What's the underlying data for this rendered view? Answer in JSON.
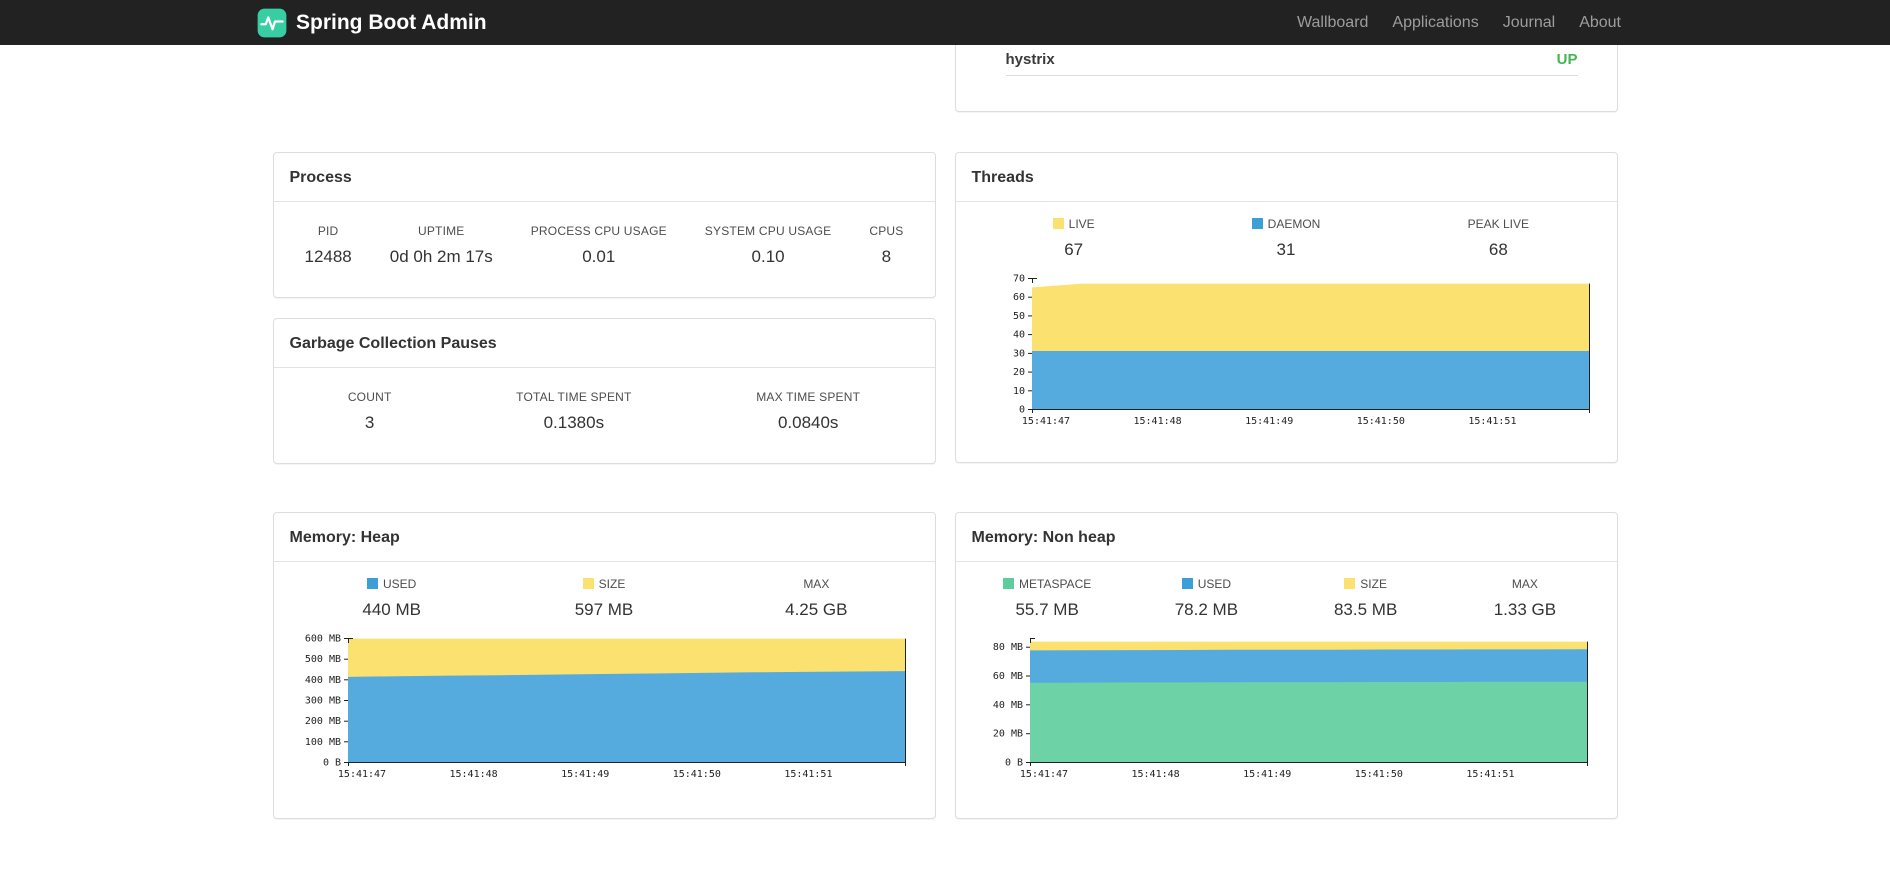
{
  "navbar": {
    "brand": "Spring Boot Admin",
    "items": [
      {
        "label": "Wallboard"
      },
      {
        "label": "Applications"
      },
      {
        "label": "Journal"
      },
      {
        "label": "About"
      }
    ]
  },
  "health": {
    "name": "hystrix",
    "status": "UP",
    "status_color": "#44b553"
  },
  "process": {
    "title": "Process",
    "stats": [
      {
        "label": "PID",
        "value": "12488"
      },
      {
        "label": "UPTIME",
        "value": "0d 0h 2m 17s"
      },
      {
        "label": "PROCESS CPU USAGE",
        "value": "0.01"
      },
      {
        "label": "SYSTEM CPU USAGE",
        "value": "0.10"
      },
      {
        "label": "CPUS",
        "value": "8"
      }
    ]
  },
  "gc": {
    "title": "Garbage Collection Pauses",
    "stats": [
      {
        "label": "COUNT",
        "value": "3"
      },
      {
        "label": "TOTAL TIME SPENT",
        "value": "0.1380s"
      },
      {
        "label": "MAX TIME SPENT",
        "value": "0.0840s"
      }
    ]
  },
  "threads": {
    "title": "Threads",
    "legend": [
      {
        "label": "LIVE",
        "value": "67",
        "swatch": "#fbe170"
      },
      {
        "label": "DAEMON",
        "value": "31",
        "swatch": "#3d9fd8"
      },
      {
        "label": "PEAK LIVE",
        "value": "68",
        "swatch": null
      }
    ]
  },
  "memory_heap": {
    "title": "Memory: Heap",
    "legend": [
      {
        "label": "USED",
        "value": "440 MB",
        "swatch": "#3d9fd8"
      },
      {
        "label": "SIZE",
        "value": "597 MB",
        "swatch": "#fbe170"
      },
      {
        "label": "MAX",
        "value": "4.25 GB",
        "swatch": null
      }
    ]
  },
  "memory_nonheap": {
    "title": "Memory: Non heap",
    "legend": [
      {
        "label": "METASPACE",
        "value": "55.7 MB",
        "swatch": "#5ecd9d"
      },
      {
        "label": "USED",
        "value": "78.2 MB",
        "swatch": "#3d9fd8"
      },
      {
        "label": "SIZE",
        "value": "83.5 MB",
        "swatch": "#fbe170"
      },
      {
        "label": "MAX",
        "value": "1.33 GB",
        "swatch": null
      }
    ]
  },
  "chart_data": [
    {
      "type": "area",
      "title": "Threads",
      "stacked": true,
      "values_are": "absolute_top",
      "x": [
        "15:41:47",
        "15:41:48",
        "15:41:49",
        "15:41:50",
        "15:41:51"
      ],
      "ylim": [
        0,
        70
      ],
      "y_ticks": [
        [
          0,
          "0"
        ],
        [
          10,
          "10"
        ],
        [
          20,
          "20"
        ],
        [
          30,
          "30"
        ],
        [
          40,
          "40"
        ],
        [
          50,
          "50"
        ],
        [
          60,
          "60"
        ],
        [
          70,
          "70"
        ]
      ],
      "legend_position": "top",
      "grid": false,
      "series": [
        {
          "name": "DAEMON",
          "color": "#55aade",
          "values": [
            31,
            31,
            31,
            31,
            31,
            31,
            31,
            31,
            31,
            31,
            31,
            31
          ]
        },
        {
          "name": "LIVE",
          "color": "#fbe170",
          "values": [
            65,
            67,
            67,
            67,
            67,
            67,
            67,
            67,
            67,
            67,
            67,
            67
          ]
        }
      ]
    },
    {
      "type": "area",
      "title": "Memory: Heap",
      "stacked": true,
      "values_are": "absolute_top",
      "x": [
        "15:41:47",
        "15:41:48",
        "15:41:49",
        "15:41:50",
        "15:41:51"
      ],
      "ylim": [
        0,
        600
      ],
      "y_ticks": [
        [
          0,
          "0 B"
        ],
        [
          100,
          "100 MB"
        ],
        [
          200,
          "200 MB"
        ],
        [
          300,
          "300 MB"
        ],
        [
          400,
          "400 MB"
        ],
        [
          500,
          "500 MB"
        ],
        [
          600,
          "600 MB"
        ]
      ],
      "legend_position": "top",
      "grid": false,
      "series": [
        {
          "name": "USED",
          "color": "#55aade",
          "values": [
            412,
            415,
            418,
            420,
            423,
            426,
            428,
            431,
            434,
            436,
            438,
            440
          ]
        },
        {
          "name": "SIZE",
          "color": "#fbe170",
          "values": [
            597,
            597,
            597,
            597,
            597,
            597,
            597,
            597,
            597,
            597,
            597,
            597
          ]
        }
      ]
    },
    {
      "type": "area",
      "title": "Memory: Non heap",
      "stacked": true,
      "values_are": "absolute_top",
      "x": [
        "15:41:47",
        "15:41:48",
        "15:41:49",
        "15:41:50",
        "15:41:51"
      ],
      "ylim": [
        0,
        86
      ],
      "y_ticks": [
        [
          0,
          "0 B"
        ],
        [
          20,
          "20 MB"
        ],
        [
          40,
          "40 MB"
        ],
        [
          60,
          "60 MB"
        ],
        [
          80,
          "80 MB"
        ]
      ],
      "legend_position": "top",
      "grid": false,
      "series": [
        {
          "name": "METASPACE",
          "color": "#6dd3a6",
          "values": [
            55.0,
            55.1,
            55.2,
            55.2,
            55.3,
            55.4,
            55.4,
            55.5,
            55.5,
            55.6,
            55.6,
            55.7
          ]
        },
        {
          "name": "USED",
          "color": "#55aade",
          "values": [
            77.4,
            77.5,
            77.6,
            77.7,
            77.8,
            77.8,
            77.9,
            78.0,
            78.0,
            78.1,
            78.1,
            78.2
          ]
        },
        {
          "name": "SIZE",
          "color": "#fbe170",
          "values": [
            83.5,
            83.5,
            83.5,
            83.5,
            83.5,
            83.5,
            83.5,
            83.5,
            83.5,
            83.5,
            83.5,
            83.5
          ]
        }
      ]
    }
  ]
}
